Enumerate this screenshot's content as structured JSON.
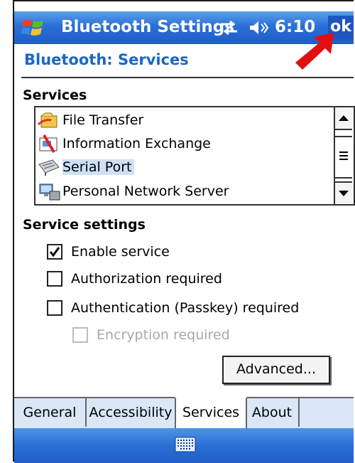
{
  "titlebar": {
    "title": "Bluetooth Settings",
    "time": "6:10",
    "ok_label": "ok"
  },
  "page": {
    "heading": "Bluetooth: Services"
  },
  "services": {
    "label": "Services",
    "items": [
      {
        "label": "File Transfer",
        "icon": "file-transfer-icon"
      },
      {
        "label": "Information Exchange",
        "icon": "information-exchange-icon"
      },
      {
        "label": "Serial Port",
        "icon": "serial-port-icon",
        "selected": true
      },
      {
        "label": "Personal Network Server",
        "icon": "network-server-icon"
      }
    ]
  },
  "settings": {
    "label": "Service settings",
    "enable_service": {
      "label": "Enable service",
      "checked": true
    },
    "authorization": {
      "label": "Authorization required",
      "checked": false
    },
    "authentication": {
      "label": "Authentication (Passkey) required",
      "checked": false
    },
    "encryption": {
      "label": "Encryption required",
      "checked": false,
      "disabled": true
    },
    "advanced_label": "Advanced..."
  },
  "tabs": [
    "General",
    "Accessibility",
    "Services",
    "About"
  ],
  "colors": {
    "accent": "#1a66c8",
    "titlebar": "#2a6fd6",
    "annotation_arrow": "#e01010"
  }
}
